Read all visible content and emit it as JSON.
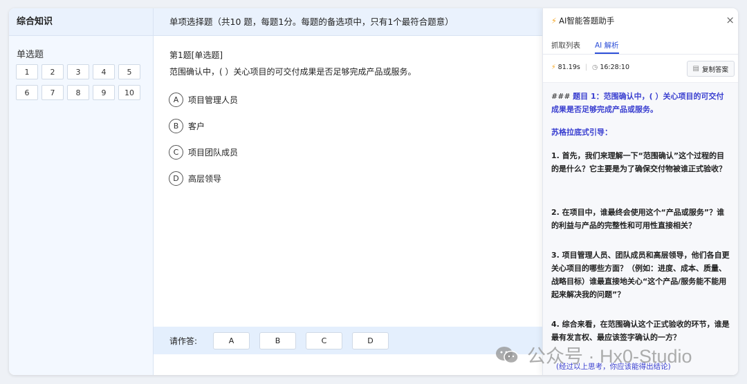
{
  "sidebar": {
    "header": "综合知识",
    "section_title": "单选题",
    "numbers": [
      "1",
      "2",
      "3",
      "4",
      "5",
      "6",
      "7",
      "8",
      "9",
      "10"
    ]
  },
  "main": {
    "header": "单项选择题（共10 题，每题1分。每题的备选项中，只有1个最符合题意）",
    "question_number": "第1题[单选题]",
    "question_text": "范围确认中，( ）关心项目的可交付成果是否足够完成产品或服务。",
    "options": [
      {
        "letter": "A",
        "text": "项目管理人员"
      },
      {
        "letter": "B",
        "text": "客户"
      },
      {
        "letter": "C",
        "text": "项目团队成员"
      },
      {
        "letter": "D",
        "text": "高层领导"
      }
    ],
    "answer_label": "请作答:",
    "answer_buttons": [
      "A",
      "B",
      "C",
      "D"
    ]
  },
  "assistant": {
    "title": "AI智能答题助手",
    "title_icon": "lightning-icon",
    "close": "×",
    "tabs": [
      {
        "label": "抓取列表",
        "active": false
      },
      {
        "label": "AI 解析",
        "active": true
      }
    ],
    "elapsed": "81.19s",
    "time": "16:28:10",
    "copy_button": "复制答案",
    "content": {
      "title_prefix": "### ",
      "title": "题目 1：范围确认中，( ）关心项目的可交付成果是否足够完成产品或服务。",
      "subheading": "苏格拉底式引导：",
      "points": [
        "1. 首先，我们来理解一下“范围确认”这个过程的目的是什么？它主要是为了确保交付物被谁正式验收？",
        "2. 在项目中，谁最终会使用这个“产品或服务”？谁的利益与产品的完整性和可用性直接相关？",
        "3. 项目管理人员、团队成员和高层领导，他们各自更关心项目的哪些方面？（例如：进度、成本、质量、战略目标）谁最直接地关心“这个产品/服务能不能用起来解决我的问题”？",
        "4. 综合来看，在范围确认这个正式验收的环节，谁是最有发言权、最应该签字确认的一方？"
      ],
      "footer": "(经过以上思考，你应该能得出结论)"
    }
  },
  "watermark": "公众号 · Hx0-Studio",
  "colors": {
    "accent": "#2d4fd8",
    "header_bg": "#eaf2fd",
    "answer_bar_bg": "#e4effd",
    "bolt": "#f5a623"
  }
}
